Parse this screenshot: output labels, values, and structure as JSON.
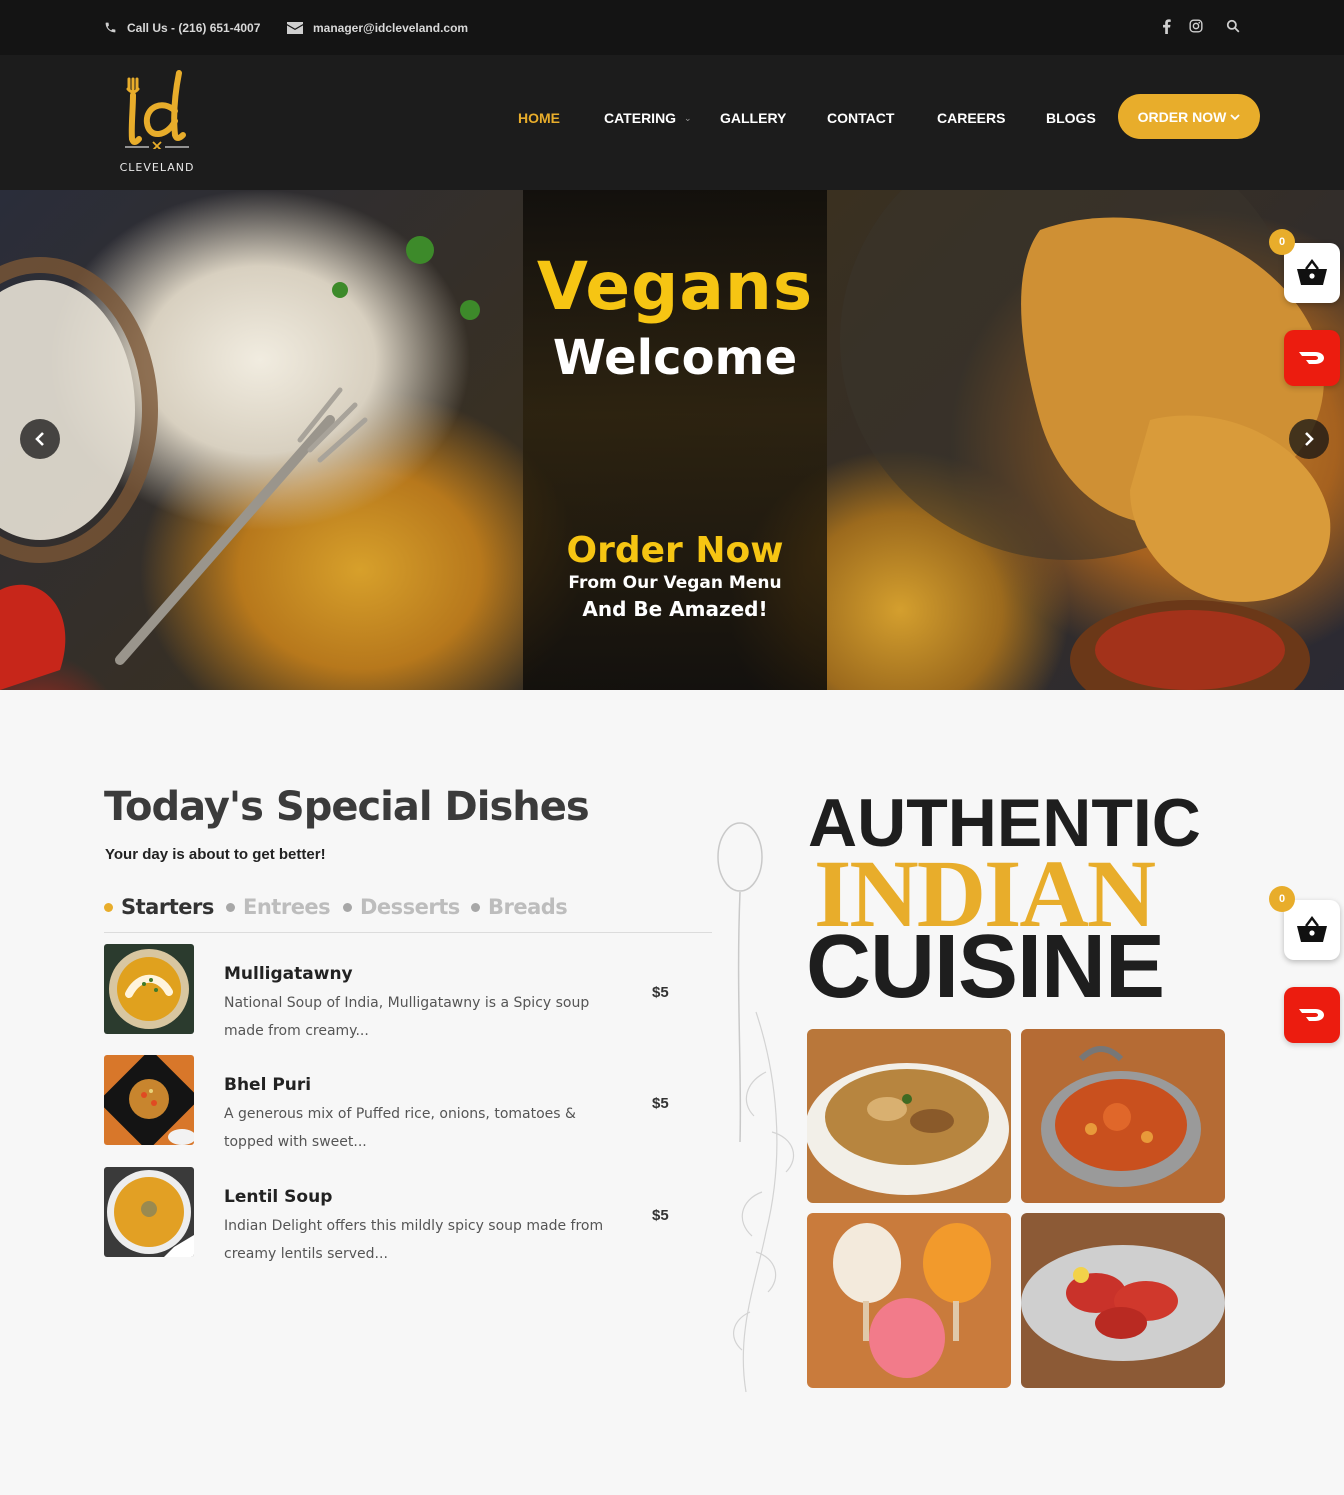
{
  "topbar": {
    "phone": "Call Us - (216) 651-4007",
    "email": "manager@idcleveland.com",
    "social_icons": [
      "facebook-icon",
      "instagram-icon",
      "search-icon"
    ]
  },
  "brand": {
    "name": "CLEVELAND",
    "accent": "#e8ad2b"
  },
  "nav": {
    "items": [
      "HOME",
      "CATERING",
      "GALLERY",
      "CONTACT",
      "CAREERS",
      "BLOGS"
    ],
    "active": "HOME",
    "order_button": "ORDER NOW"
  },
  "hero": {
    "title": "Vegans",
    "subtitle": "Welcome",
    "cta_title": "Order Now",
    "cta_line1": "From Our Vegan Menu",
    "cta_line2": "And Be Amazed!"
  },
  "floating": {
    "cart_count_1": "0",
    "cart_count_2": "0"
  },
  "specials": {
    "title": "Today's Special Dishes",
    "subtitle": "Your day is about to get better!",
    "tabs": [
      "Starters",
      "Entrees",
      "Desserts",
      "Breads"
    ],
    "active_tab": "Starters",
    "dishes": [
      {
        "name": "Mulligatawny",
        "desc": "National Soup of India, Mulligatawny is a Spicy soup made from creamy...",
        "price": "$5"
      },
      {
        "name": "Bhel Puri",
        "desc": "A generous mix of Puffed rice, onions, tomatoes & topped with sweet...",
        "price": "$5"
      },
      {
        "name": "Lentil Soup",
        "desc": "Indian Delight offers this mildly spicy soup made from creamy lentils served...",
        "price": "$5"
      }
    ]
  },
  "authentic": {
    "line1": "AUTHENTIC",
    "line2": "INDIAN",
    "line3": "CUISINE"
  }
}
